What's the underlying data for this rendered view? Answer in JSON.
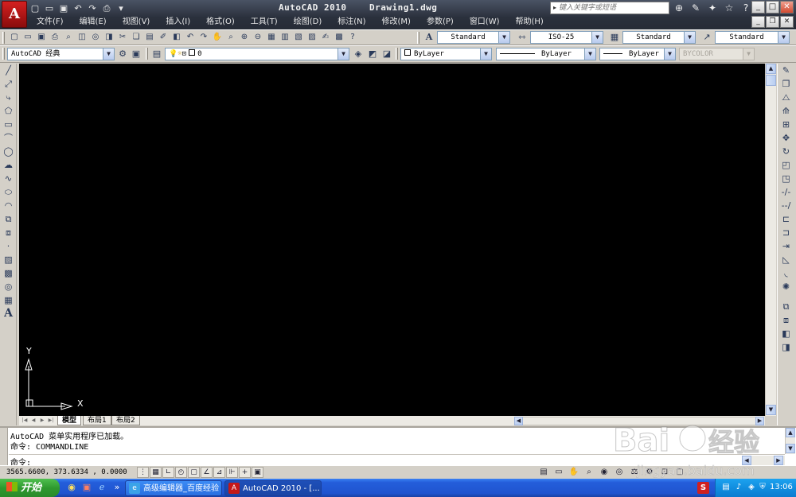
{
  "window": {
    "title": "AutoCAD 2010    Drawing1.dwg",
    "search_placeholder": "键入关键字或短语",
    "title_tools": [
      "binoculars-icon",
      "wrench-icon",
      "exchange-icon",
      "star-icon",
      "help-icon"
    ],
    "logo_glyph": "A"
  },
  "quick_access": [
    "new-icon",
    "open-icon",
    "save-icon",
    "undo-icon",
    "redo-icon",
    "plot-icon"
  ],
  "menu": [
    "文件(F)",
    "编辑(E)",
    "视图(V)",
    "插入(I)",
    "格式(O)",
    "工具(T)",
    "绘图(D)",
    "标注(N)",
    "修改(M)",
    "参数(P)",
    "窗口(W)",
    "帮助(H)"
  ],
  "toolbar1": {
    "text_style": "Standard",
    "dim_style": "ISO-25",
    "table_style": "Standard",
    "multileader_style": "Standard"
  },
  "toolbar2": {
    "workspace": "AutoCAD 经典",
    "layer": "0",
    "color": "ByLayer",
    "linetype": "ByLayer",
    "lineweight": "ByLayer",
    "plot_style": "BYCOLOR"
  },
  "ucs": {
    "x_label": "X",
    "y_label": "Y"
  },
  "layout_tabs": [
    "模型",
    "布局1",
    "布局2"
  ],
  "command": {
    "history": [
      "AutoCAD 菜单实用程序已加载。",
      "命令: COMMANDLINE"
    ],
    "prompt": "命令:"
  },
  "status": {
    "coordinates": "3565.6600, 373.6334 , 0.0000"
  },
  "taskbar": {
    "start_label": "开始",
    "tasks": [
      "高级编辑器_百度经验",
      "AutoCAD 2010 - [..."
    ],
    "clock": "13:06"
  },
  "colors": {
    "canvas": "#000000",
    "title_bar": "#2a303c",
    "taskbar": "#245edb",
    "start_button": "#2f9a2f"
  }
}
